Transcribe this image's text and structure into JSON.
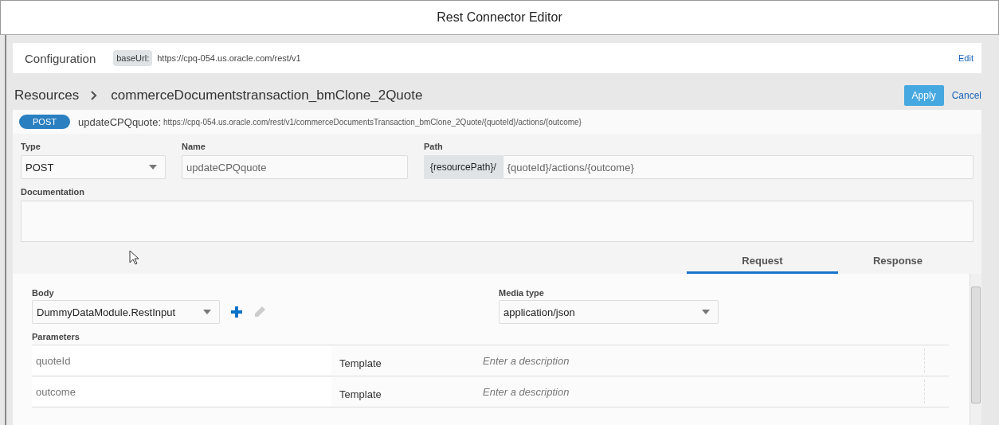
{
  "window": {
    "title": "Rest Connector Editor"
  },
  "configuration": {
    "label": "Configuration",
    "base_url_label": "baseUrl:",
    "base_url": "https://cpq-054.us.oracle.com/rest/v1",
    "edit_link": "Edit"
  },
  "breadcrumb": {
    "root": "Resources",
    "current": "commerceDocumentstransaction_bmClone_2Quote"
  },
  "actions": [
    {
      "label": "Apply",
      "kind": "primary"
    },
    {
      "label": "Cancel",
      "kind": "link"
    }
  ],
  "resource": {
    "method": "POST",
    "name": "updateCPQquote:",
    "url": "https://cpq-054.us.oracle.com/rest/v1/commerceDocumentsTransaction_bmClone_2Quote/{quoteId}/actions/{outcome}"
  },
  "form": {
    "type": {
      "label": "Type",
      "value": "POST"
    },
    "name": {
      "label": "Name",
      "value": "updateCPQquote"
    },
    "path": {
      "label": "Path",
      "prefix": "{resourcePath}/",
      "value": "{quoteId}/actions/{outcome}"
    },
    "documentation": {
      "label": "Documentation"
    }
  },
  "tabs": [
    {
      "label": "Request",
      "selected": true
    },
    {
      "label": "Response",
      "selected": false
    }
  ],
  "request": {
    "body": {
      "label": "Body",
      "value": "DummyDataModule.RestInput",
      "edit_disabled": true
    },
    "media_type": {
      "label": "Media type",
      "value": "application/json"
    },
    "parameters": {
      "label": "Parameters",
      "rows": [
        {
          "name": "quoteId",
          "type": "Template",
          "description_placeholder": "Enter a description"
        },
        {
          "name": "outcome",
          "type": "Template",
          "description_placeholder": "Enter a description"
        }
      ]
    }
  }
}
